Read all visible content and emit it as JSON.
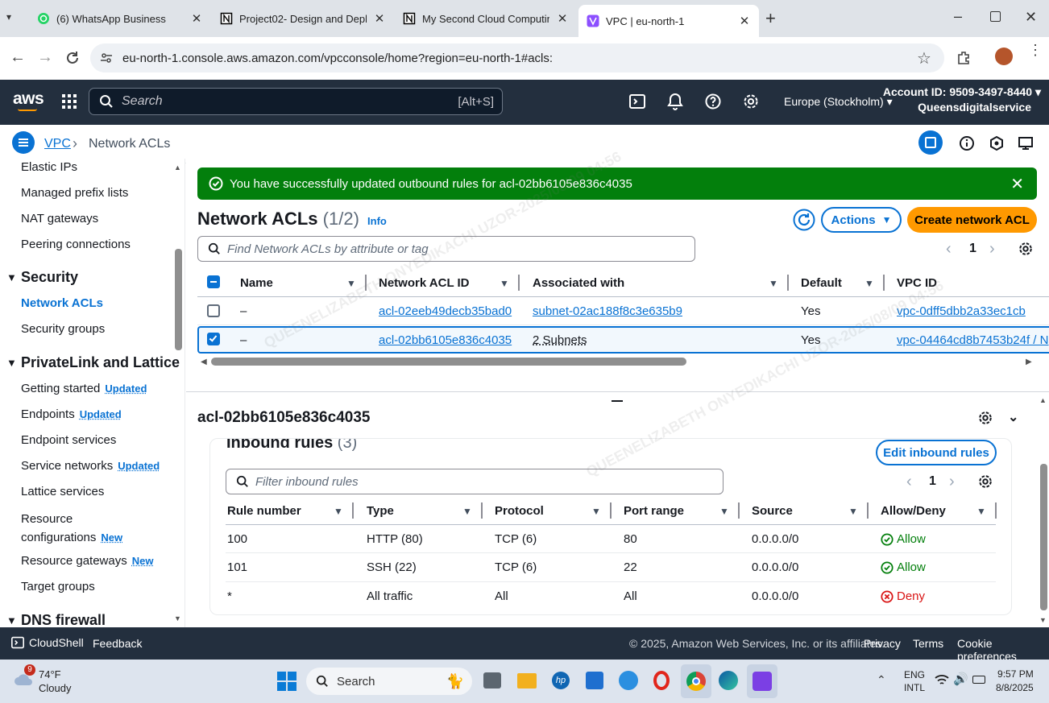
{
  "browser": {
    "tabs": [
      {
        "label": "(6) WhatsApp Business",
        "icon": "whatsapp-icon"
      },
      {
        "label": "Project02- Design and Deploym",
        "icon": "notion-icon"
      },
      {
        "label": "My Second Cloud Computing P",
        "icon": "notion-icon"
      },
      {
        "label": "VPC | eu-north-1",
        "icon": "vpc-icon"
      }
    ],
    "url": "eu-north-1.console.aws.amazon.com/vpcconsole/home?region=eu-north-1#acls:"
  },
  "aws_header": {
    "search_placeholder": "Search",
    "search_shortcut": "[Alt+S]",
    "region": "Europe (Stockholm)",
    "account_id": "Account ID: 9509-3497-8440",
    "account_name": "Queensdigitalservice"
  },
  "breadcrumb": {
    "root": "VPC",
    "current": "Network ACLs"
  },
  "sidebar": {
    "items_top": [
      "Elastic IPs",
      "Managed prefix lists",
      "NAT gateways",
      "Peering connections"
    ],
    "security_title": "Security",
    "security_items": [
      "Network ACLs",
      "Security groups"
    ],
    "privatelink_title": "PrivateLink and Lattice",
    "privatelink_items": [
      {
        "label": "Getting started",
        "badge": "Updated"
      },
      {
        "label": "Endpoints",
        "badge": "Updated"
      },
      {
        "label": "Endpoint services",
        "badge": ""
      },
      {
        "label": "Service networks",
        "badge": "Updated"
      },
      {
        "label": "Lattice services",
        "badge": ""
      },
      {
        "label": "Resource configurations",
        "badge": "New"
      },
      {
        "label": "Resource gateways",
        "badge": "New"
      },
      {
        "label": "Target groups",
        "badge": ""
      }
    ],
    "dns_title": "DNS firewall"
  },
  "flash": {
    "message": "You have successfully updated outbound rules for acl-02bb6105e836c4035"
  },
  "acl_panel": {
    "title": "Network ACLs",
    "count": "(1/2)",
    "info": "Info",
    "actions_label": "Actions",
    "create_label": "Create network ACL",
    "filter_placeholder": "Find Network ACLs by attribute or tag",
    "page": "1",
    "columns": [
      "Name",
      "Network ACL ID",
      "Associated with",
      "Default",
      "VPC ID"
    ],
    "rows": [
      {
        "name": "–",
        "acl_id": "acl-02eeb49decb35bad0",
        "associated": "subnet-02ac188f8c3e635b9",
        "default": "Yes",
        "vpc": "vpc-0dff5dbb2a33ec1cb",
        "selected": false
      },
      {
        "name": "–",
        "acl_id": "acl-02bb6105e836c4035",
        "associated": "2 Subnets",
        "default": "Yes",
        "vpc": "vpc-04464cd8b7453b24f / N",
        "selected": true
      }
    ]
  },
  "detail": {
    "title": "acl-02bb6105e836c4035",
    "inbound_title": "Inbound rules",
    "inbound_count": "(3)",
    "edit_label": "Edit inbound rules",
    "filter_placeholder": "Filter inbound rules",
    "page": "1",
    "columns": [
      "Rule number",
      "Type",
      "Protocol",
      "Port range",
      "Source",
      "Allow/Deny"
    ],
    "rules": [
      {
        "rule": "100",
        "type": "HTTP (80)",
        "protocol": "TCP (6)",
        "port": "80",
        "source": "0.0.0.0/0",
        "action": "Allow"
      },
      {
        "rule": "101",
        "type": "SSH (22)",
        "protocol": "TCP (6)",
        "port": "22",
        "source": "0.0.0.0/0",
        "action": "Allow"
      },
      {
        "rule": "*",
        "type": "All traffic",
        "protocol": "All",
        "port": "All",
        "source": "0.0.0.0/0",
        "action": "Deny"
      }
    ]
  },
  "footer": {
    "cloudshell": "CloudShell",
    "feedback": "Feedback",
    "copyright": "© 2025, Amazon Web Services, Inc. or its affiliates.",
    "privacy": "Privacy",
    "terms": "Terms",
    "cookies": "Cookie preferences"
  },
  "taskbar": {
    "weather_temp": "74°F",
    "weather_desc": "Cloudy",
    "weather_badge": "9",
    "search_label": "Search",
    "lang1": "ENG",
    "lang2": "INTL",
    "time": "9:57 PM",
    "date": "8/8/2025"
  },
  "watermark": "QUEENELIZABETH ONYEDIKACHI UZOR-2025/08/09 04:56",
  "colors": {
    "aws_dark": "#232f3e",
    "link_blue": "#0972d3",
    "success_green": "#037f0c",
    "primary_orange": "#ff9900",
    "deny_red": "#d91515"
  }
}
